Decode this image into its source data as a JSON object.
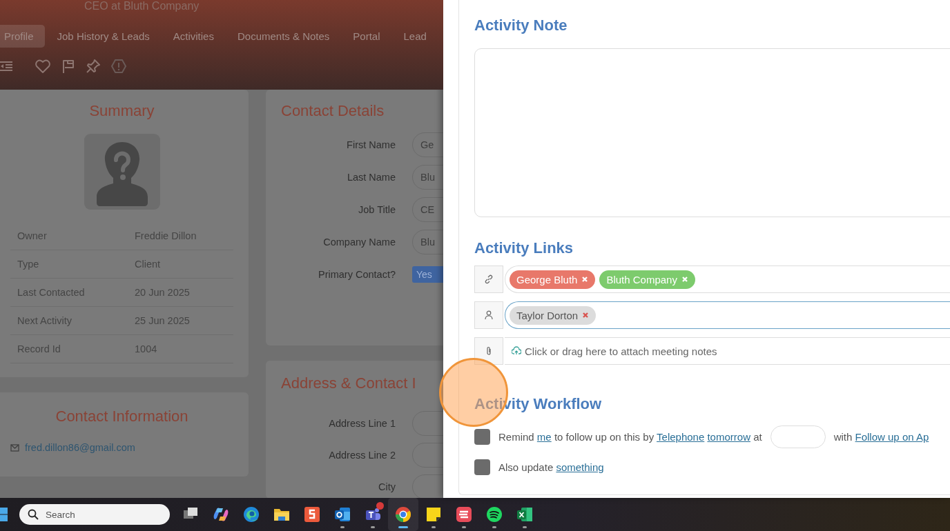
{
  "profile": {
    "subtitle": "CEO at Bluth Company",
    "tabs": [
      {
        "label": "Profile",
        "selected": true
      },
      {
        "label": "Job History & Leads",
        "selected": false
      },
      {
        "label": "Activities",
        "selected": false
      },
      {
        "label": "Documents & Notes",
        "selected": false
      },
      {
        "label": "Portal",
        "selected": false
      },
      {
        "label": "Lead",
        "selected": false
      }
    ],
    "summary": {
      "title": "Summary",
      "rows": [
        {
          "label": "Owner",
          "value": "Freddie Dillon"
        },
        {
          "label": "Type",
          "value": "Client"
        },
        {
          "label": "Last Contacted",
          "value": "20 Jun 2025"
        },
        {
          "label": "Next Activity",
          "value": "25 Jun 2025"
        },
        {
          "label": "Record Id",
          "value": "1004"
        }
      ]
    },
    "contact_information": {
      "title": "Contact Information",
      "email": "fred.dillon86@gmail.com"
    },
    "contact_details": {
      "title": "Contact Details",
      "fields": [
        {
          "label": "First Name",
          "value": "Ge"
        },
        {
          "label": "Last Name",
          "value": "Blu"
        },
        {
          "label": "Job Title",
          "value": "CE"
        },
        {
          "label": "Company Name",
          "value": "Blu"
        }
      ],
      "primary_contact": {
        "label": "Primary Contact?",
        "value": "Yes",
        "on": true
      }
    },
    "address": {
      "title": "Address & Contact I",
      "fields": [
        {
          "label": "Address Line 1"
        },
        {
          "label": "Address Line 2"
        },
        {
          "label": "City"
        }
      ]
    }
  },
  "activity": {
    "note": {
      "title": "Activity Note"
    },
    "links": {
      "title": "Activity Links",
      "rows": [
        {
          "kind": "tags",
          "focused": false,
          "tags": [
            {
              "label": "George Bluth",
              "color": "#e8786a"
            },
            {
              "label": "Bluth Company",
              "color": "#7dcb6d"
            }
          ]
        },
        {
          "kind": "tags",
          "focused": true,
          "tags": [
            {
              "label": "Taylor Dorton",
              "color": "#dcdcdc"
            }
          ]
        },
        {
          "kind": "upload",
          "focused": false,
          "text": "Click or drag here to attach meeting notes"
        }
      ]
    },
    "workflow": {
      "title": "Activity Workflow",
      "rows": [
        {
          "checked": false,
          "parts": [
            {
              "kind": "text",
              "text": "Remind"
            },
            {
              "kind": "link",
              "text": "me"
            },
            {
              "kind": "text",
              "text": "to follow up on this by"
            },
            {
              "kind": "link",
              "text": "Telephone"
            },
            {
              "kind": "link",
              "text": "tomorrow"
            },
            {
              "kind": "text",
              "text": "at"
            },
            {
              "kind": "field"
            },
            {
              "kind": "text",
              "text": "with"
            },
            {
              "kind": "link",
              "text": "Follow up on Ap"
            }
          ]
        },
        {
          "checked": false,
          "parts": [
            {
              "kind": "text",
              "text": "Also update"
            },
            {
              "kind": "link",
              "text": "something"
            }
          ]
        }
      ]
    }
  },
  "taskbar": {
    "search": {
      "placeholder": "Search"
    },
    "apps": [
      {
        "kind": "taskview",
        "running": false,
        "active": false,
        "notification": false
      },
      {
        "kind": "copilot",
        "running": false,
        "active": false,
        "notification": false
      },
      {
        "kind": "edge",
        "running": false,
        "active": false,
        "notification": false
      },
      {
        "kind": "explorer",
        "running": false,
        "active": false,
        "notification": false
      },
      {
        "kind": "snagit",
        "running": false,
        "active": false,
        "notification": false
      },
      {
        "kind": "outlook",
        "running": true,
        "active": false,
        "notification": false
      },
      {
        "kind": "teams",
        "running": true,
        "active": false,
        "notification": true
      },
      {
        "kind": "chrome",
        "running": true,
        "active": true,
        "notification": false
      },
      {
        "kind": "sticky",
        "running": true,
        "active": false,
        "notification": false
      },
      {
        "kind": "todo",
        "running": true,
        "active": false,
        "notification": false
      },
      {
        "kind": "spotify",
        "running": true,
        "active": false,
        "notification": false
      },
      {
        "kind": "excel",
        "running": true,
        "active": false,
        "notification": false
      }
    ]
  }
}
